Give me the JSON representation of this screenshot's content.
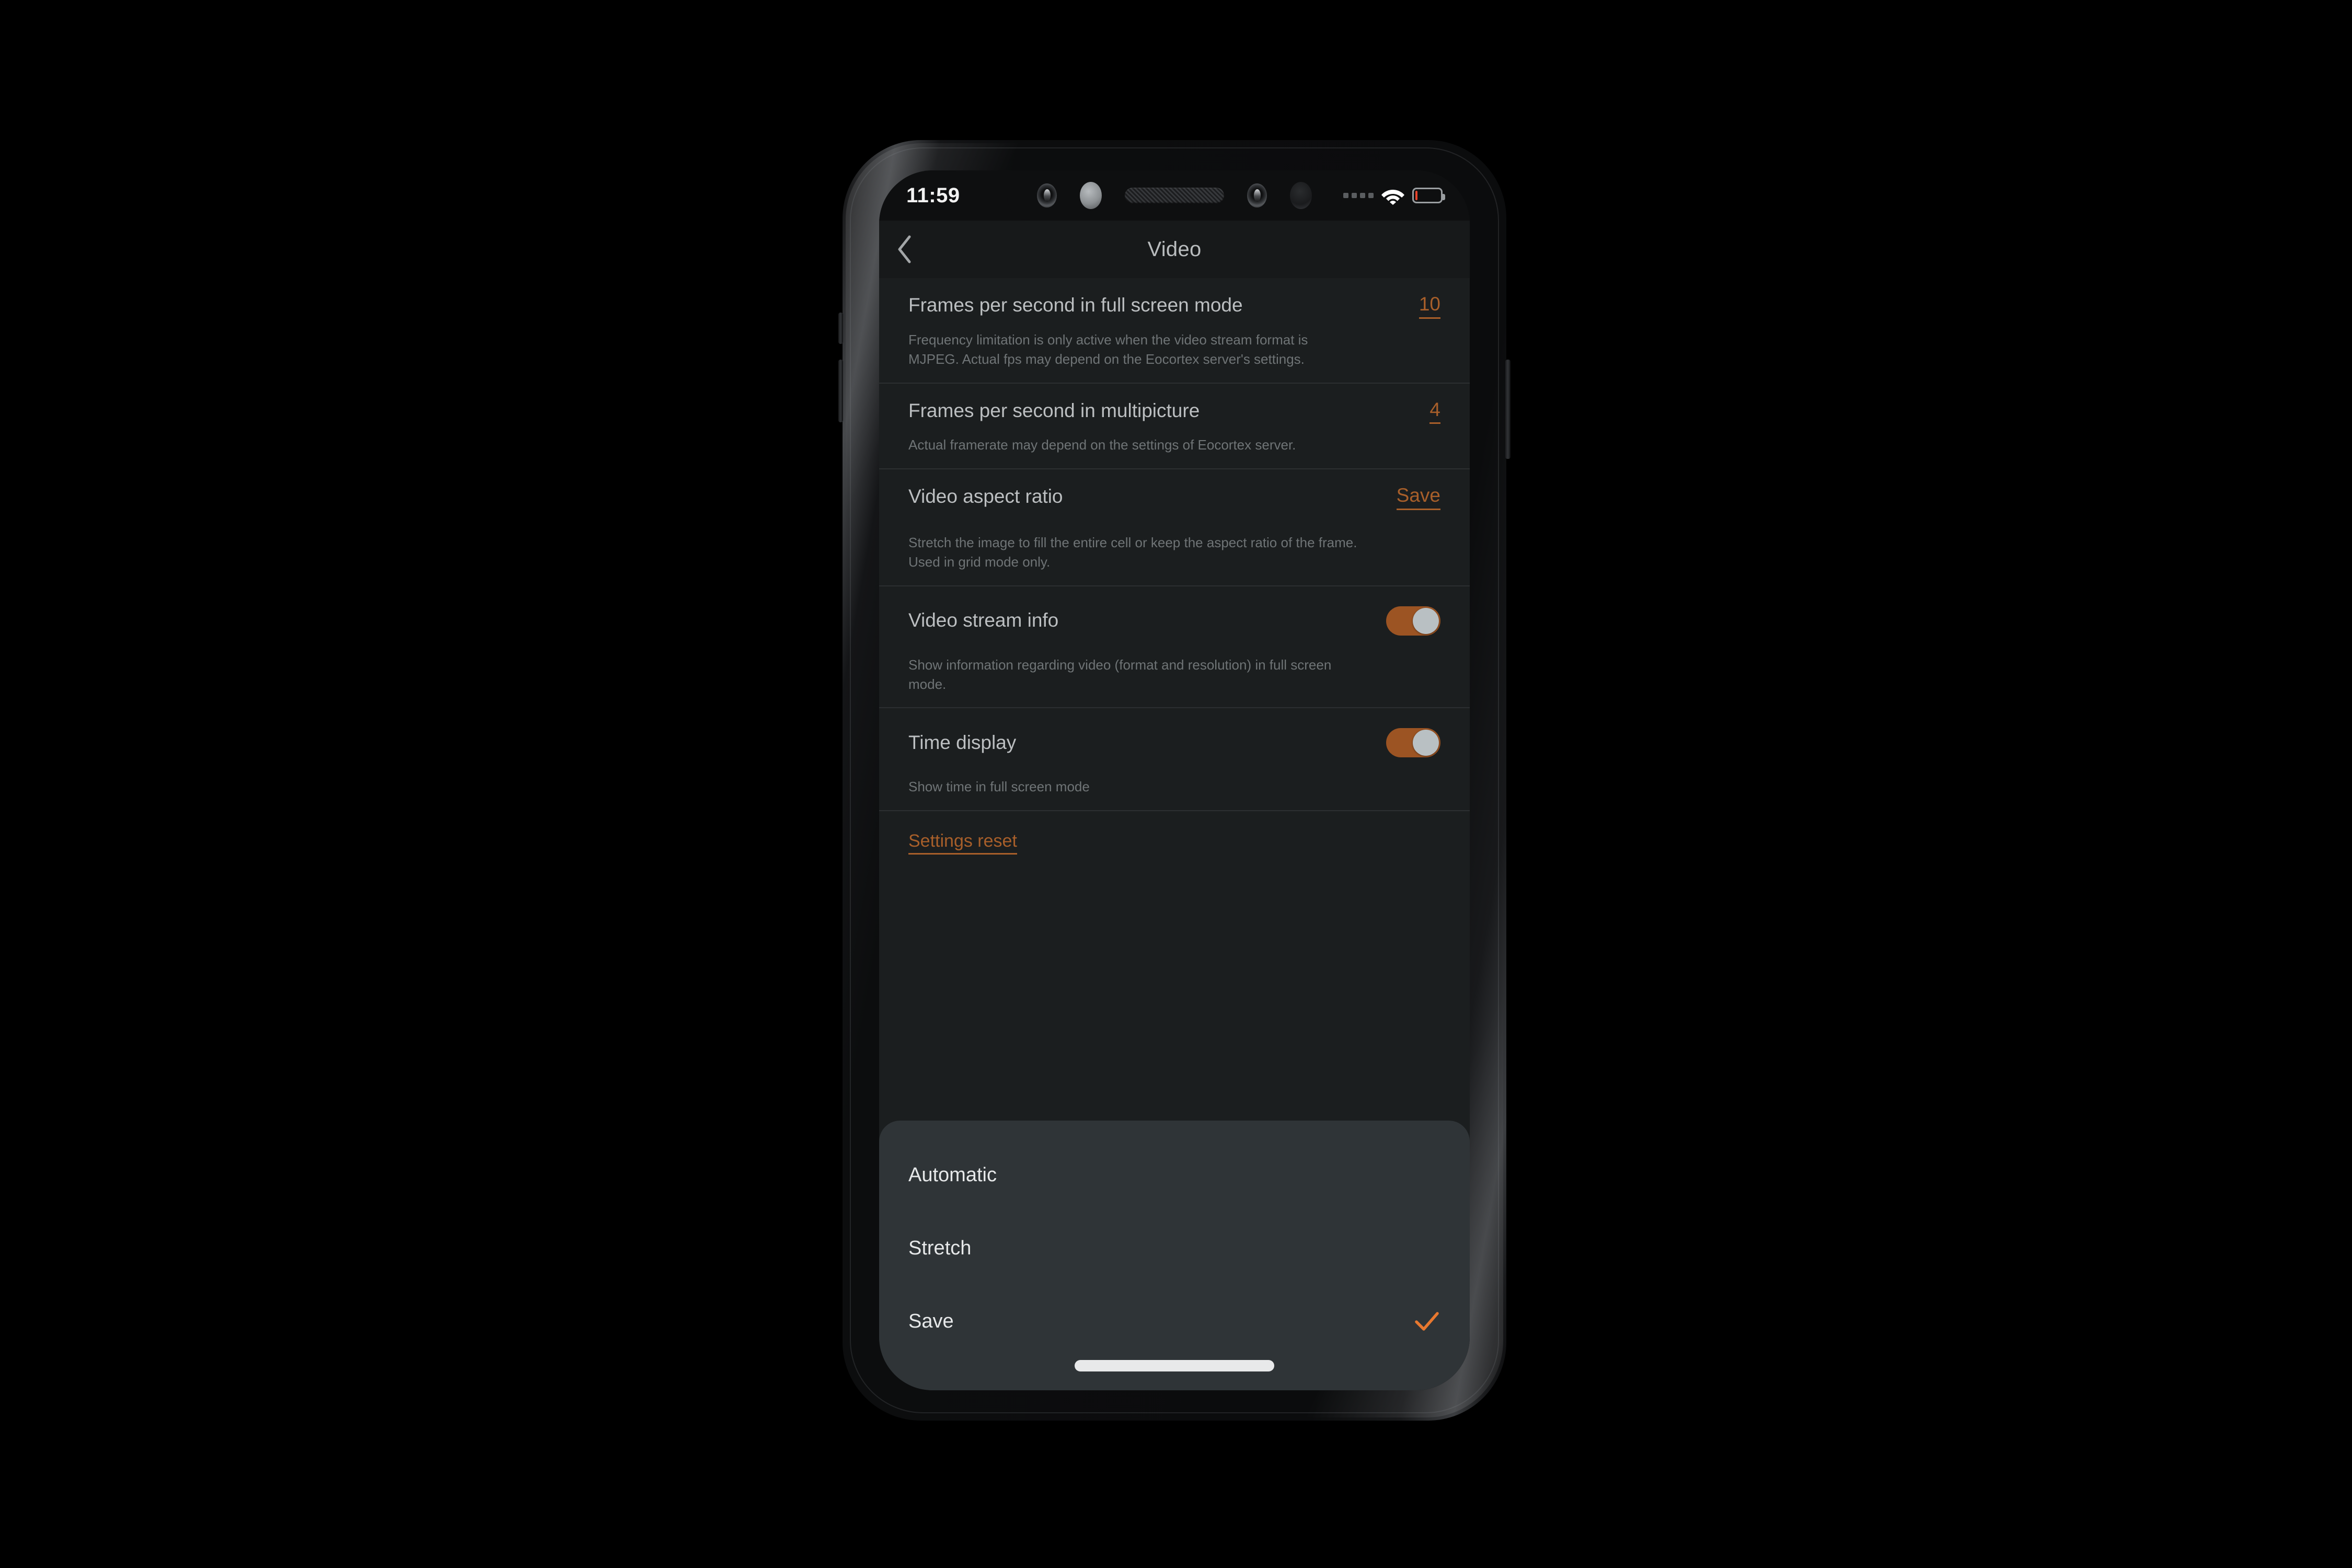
{
  "statusbar": {
    "time": "11:59",
    "signal_icon": "signal-dots-icon",
    "wifi_icon": "wifi-icon",
    "battery_icon": "battery-low-icon",
    "battery_level_percent": 8,
    "battery_color": "#e8432b"
  },
  "appbar": {
    "back_icon": "chevron-left-icon",
    "title": "Video"
  },
  "theme": {
    "accent": "#a85f2a",
    "accent_bright": "#e8782f",
    "toggle_track_on": "#9c5423",
    "toggle_knob": "#b9c0c3",
    "screen_bg": "#1b1e1f",
    "appbar_bg": "#17191a",
    "sheet_bg": "#2f3437"
  },
  "settings": {
    "rows": [
      {
        "title": "Frames per second in full screen mode",
        "value": "10",
        "description": "Frequency limitation is only active when the video stream format is MJPEG. Actual fps may depend on the Eocortex server's settings."
      },
      {
        "title": "Frames per second in multipicture",
        "value": "4",
        "description": "Actual framerate may depend on the settings of Eocortex server."
      },
      {
        "title": "Video aspect ratio",
        "value": "Save",
        "description": "Stretch the image to fill the entire cell or keep the aspect ratio of the frame. Used in grid mode only."
      },
      {
        "title": "Video stream info",
        "toggle": "on",
        "description": "Show information regarding video (format and resolution) in full screen mode."
      },
      {
        "title": "Time display",
        "toggle": "on",
        "description": "Show time in full screen mode"
      }
    ],
    "reset_link": "Settings reset"
  },
  "bottom_sheet": {
    "options": [
      {
        "label": "Automatic",
        "selected": false
      },
      {
        "label": "Stretch",
        "selected": false
      },
      {
        "label": "Save",
        "selected": true
      }
    ],
    "check_icon": "check-icon"
  },
  "home_indicator": "home-indicator"
}
